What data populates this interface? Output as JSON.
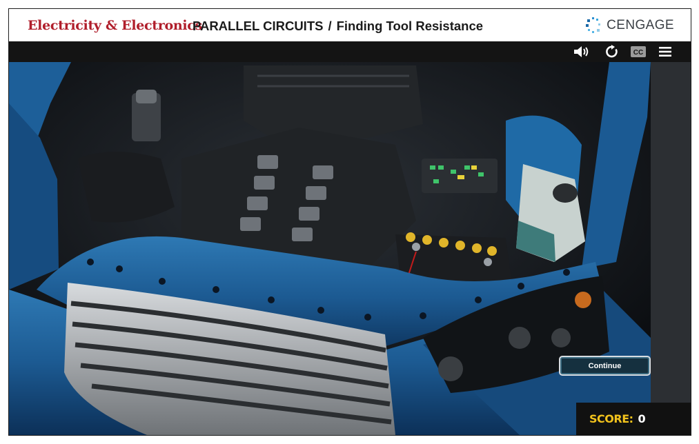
{
  "header": {
    "course_title": "Electricity & Electronics",
    "section": "PARALLEL CIRCUITS",
    "separator": "/",
    "lesson": "Finding Tool Resistance",
    "logo_text": "CENGAGE"
  },
  "toolbar": {
    "icons": [
      "volume-icon",
      "replay-icon",
      "closed-captions-icon",
      "menu-icon"
    ],
    "cc_label": "CC"
  },
  "scene": {
    "description_icon": "car-engine-bay-illustration"
  },
  "continue_button": {
    "label": "Continue"
  },
  "score": {
    "label": "SCORE:",
    "value": "0"
  },
  "colors": {
    "title_red": "#b01e2b",
    "score_yellow": "#f2c21c",
    "car_blue": "#1f5f96",
    "battery_terminal_yellow": "#e0b52a"
  }
}
